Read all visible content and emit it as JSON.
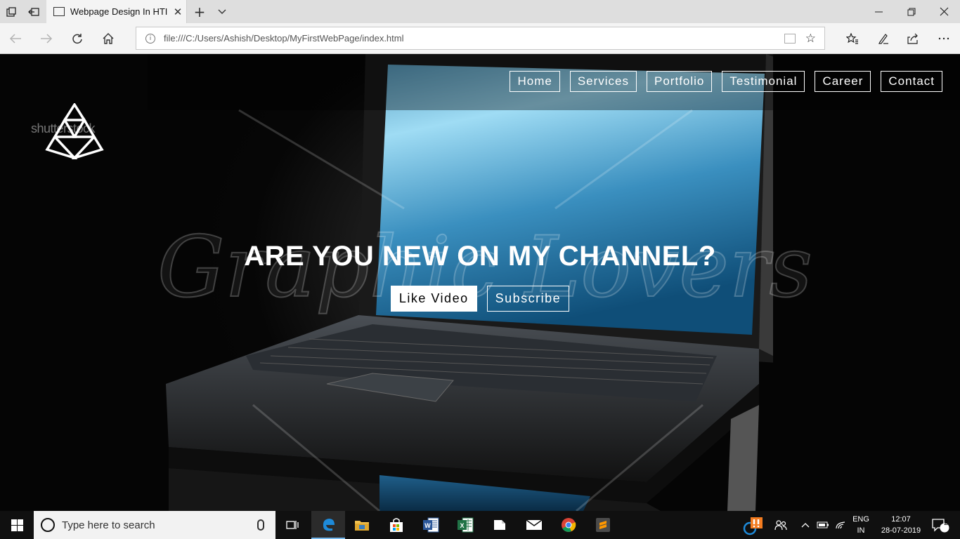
{
  "browser": {
    "tab_title": "Webpage Design In HTI",
    "url": "file:///C:/Users/Ashish/Desktop/MyFirstWebPage/index.html"
  },
  "page": {
    "logo_watermark_text": "shutterstock",
    "nav": [
      {
        "label": "Home"
      },
      {
        "label": "Services"
      },
      {
        "label": "Portfolio"
      },
      {
        "label": "Testimonial"
      },
      {
        "label": "Career"
      },
      {
        "label": "Contact"
      }
    ],
    "hero": {
      "heading": "ARE YOU NEW ON MY CHANNEL?",
      "primary_button": "Like Video",
      "secondary_button": "Subscribe"
    },
    "watermark_text": "Graphic Lovers"
  },
  "taskbar": {
    "search_placeholder": "Type here to search",
    "language": {
      "line1": "ENG",
      "line2": "IN"
    },
    "time": "12:07",
    "date": "28-07-2019",
    "notification_count": "2"
  },
  "colors": {
    "accent_blue": "#76b9ed",
    "chrome_bg": "#dedede",
    "page_bg": "#050505"
  }
}
